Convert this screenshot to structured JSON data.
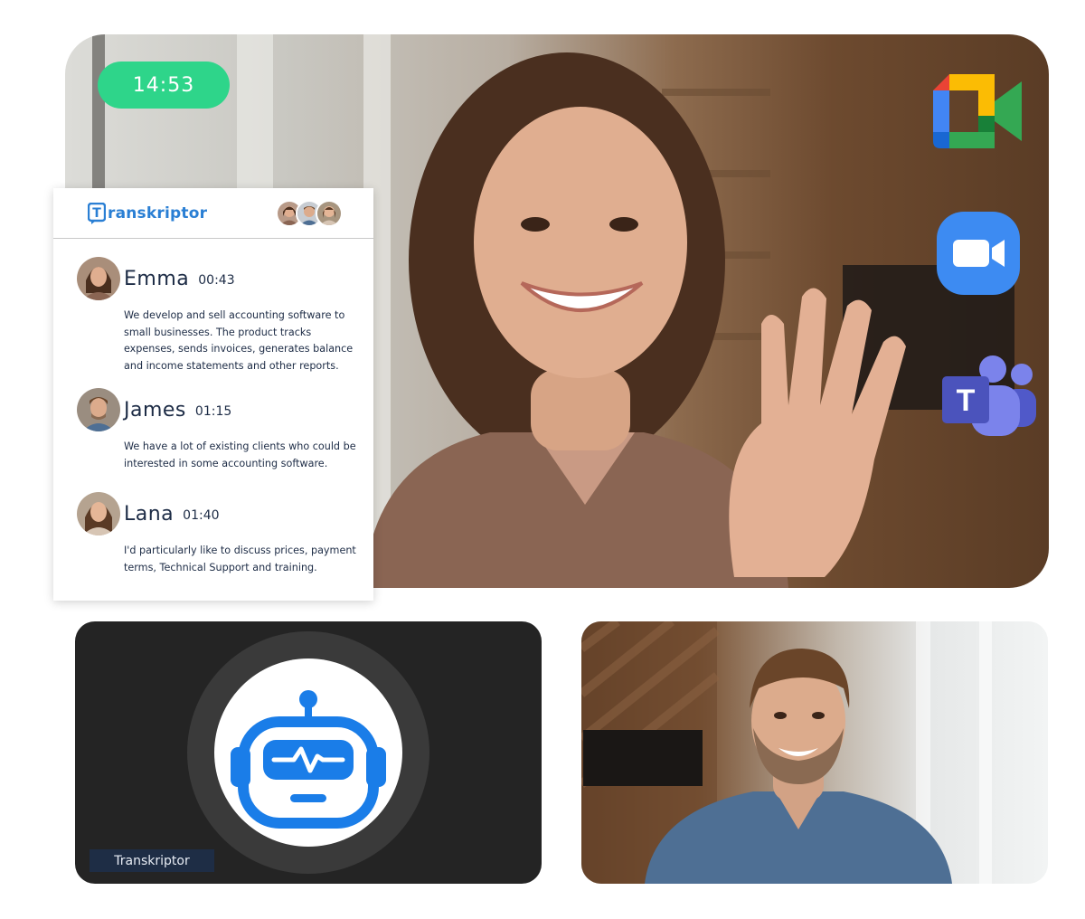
{
  "call": {
    "timer": "14:53"
  },
  "apps": [
    {
      "name": "google-meet-icon"
    },
    {
      "name": "zoom-icon"
    },
    {
      "name": "teams-icon",
      "letter": "T"
    }
  ],
  "transcript": {
    "brand": "ranskriptor",
    "brand_initial": "T",
    "entries": [
      {
        "name": "Emma",
        "time": "00:43",
        "text": "We develop and sell accounting software to small businesses. The product tracks expenses, sends invoices, generates balance and income statements and other reports."
      },
      {
        "name": "James",
        "time": "01:15",
        "text": "We have a lot of existing clients who could be interested in some accounting software."
      },
      {
        "name": "Lana",
        "time": "01:40",
        "text": "I'd particularly like to discuss prices, payment terms, Technical Support and training."
      }
    ]
  },
  "bot": {
    "label": "Transkriptor",
    "color": "#1a7de8"
  },
  "colors": {
    "timer_pill": "#2ed58a",
    "brand_blue": "#2a7fd4",
    "bot_tile": "#242424"
  }
}
